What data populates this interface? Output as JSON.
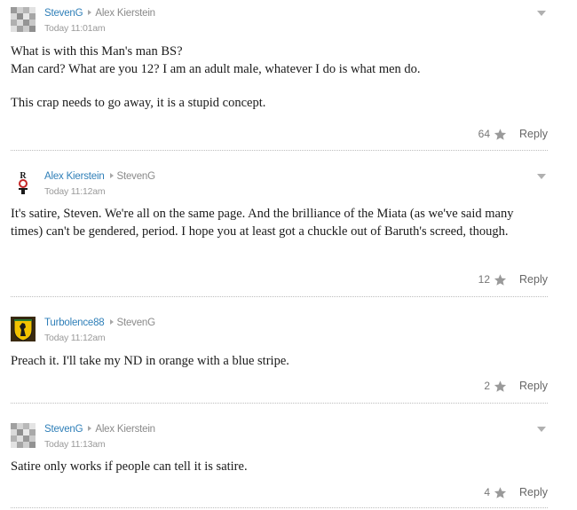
{
  "comments": [
    {
      "author": "StevenG",
      "reply_to": "Alex Kierstein",
      "timestamp": "Today 11:01am",
      "avatar": "pixelated-avatar",
      "paragraphs": [
        "What is with this Man's man BS?",
        "Man card? What are you 12? I am an adult male, whatever I do is what men do.",
        "This crap needs to go away, it is a stupid concept."
      ],
      "likes": "64",
      "reply_label": "Reply"
    },
    {
      "author": "Alex Kierstein",
      "reply_to": "StevenG",
      "timestamp": "Today 11:12am",
      "avatar": "rot-logo-avatar",
      "paragraphs": [
        "It's satire, Steven. We're all on the same page. And the brilliance of the Miata (as we've said many times) can't be gendered, period. I hope you at least got a chuckle out of Baruth's screed, though."
      ],
      "likes": "12",
      "reply_label": "Reply"
    },
    {
      "author": "Turbolence88",
      "reply_to": "StevenG",
      "timestamp": "Today 11:12am",
      "avatar": "horse-shield-avatar",
      "paragraphs": [
        "Preach it. I'll take my ND in orange with a blue stripe."
      ],
      "likes": "2",
      "reply_label": "Reply"
    },
    {
      "author": "StevenG",
      "reply_to": "Alex Kierstein",
      "timestamp": "Today 11:13am",
      "avatar": "pixelated-avatar",
      "paragraphs": [
        "Satire only works if people can tell it is satire."
      ],
      "likes": "4",
      "reply_label": "Reply"
    }
  ],
  "colors": {
    "author_link": "#2f7fb8",
    "meta_gray": "#8a8a8a",
    "star_gray": "#9a9a9a",
    "divider": "#bdbdbd"
  }
}
